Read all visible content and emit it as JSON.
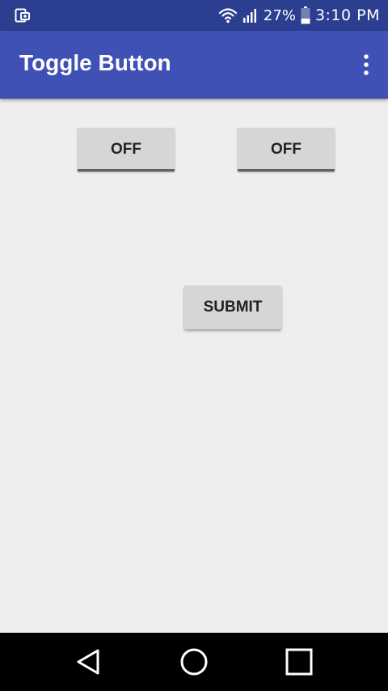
{
  "status_bar": {
    "battery_percent": "27%",
    "time": "3:10 PM",
    "icons": [
      "screenshot-notification-icon",
      "wifi-icon",
      "signal-icon",
      "battery-icon"
    ]
  },
  "app_bar": {
    "title": "Toggle Button",
    "menu_icon": "overflow-menu-icon"
  },
  "content": {
    "toggle1": {
      "label": "OFF",
      "checked": false
    },
    "toggle2": {
      "label": "OFF",
      "checked": false
    },
    "submit": {
      "label": "SUBMIT"
    }
  },
  "nav_bar": {
    "icons": [
      "back-icon",
      "home-icon",
      "recents-icon"
    ]
  },
  "colors": {
    "status_bar": "#2c3e8f",
    "app_bar": "#3f51b5",
    "background": "#eeeeee",
    "button": "#d6d6d6",
    "toggle_indicator_off": "#606060",
    "nav_bar": "#000000"
  }
}
